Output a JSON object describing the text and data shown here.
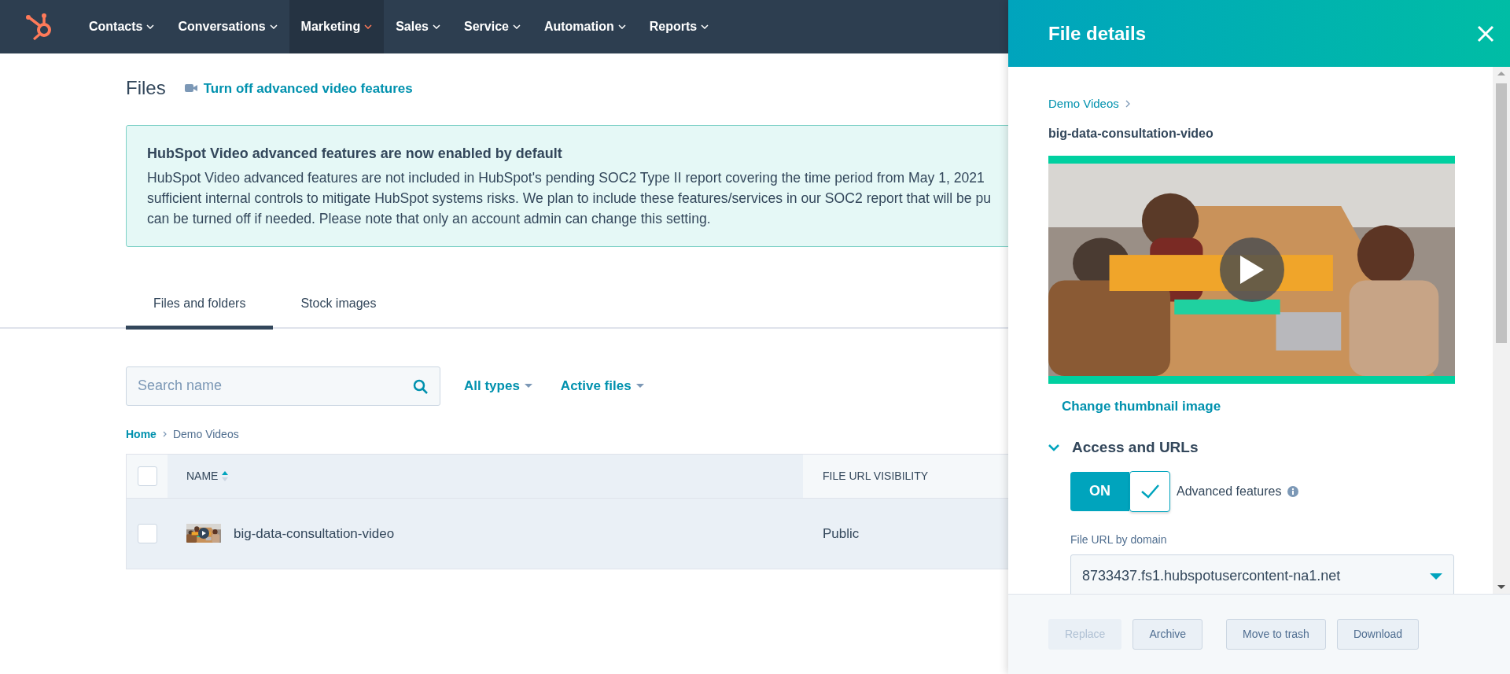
{
  "nav": {
    "items": [
      {
        "label": "Contacts",
        "selected": false
      },
      {
        "label": "Conversations",
        "selected": false
      },
      {
        "label": "Marketing",
        "selected": true
      },
      {
        "label": "Sales",
        "selected": false
      },
      {
        "label": "Service",
        "selected": false
      },
      {
        "label": "Automation",
        "selected": false
      },
      {
        "label": "Reports",
        "selected": false
      }
    ]
  },
  "page": {
    "title": "Files",
    "video_link": "Turn off advanced video features"
  },
  "banner": {
    "title": "HubSpot Video advanced features are now enabled by default",
    "lines": [
      "HubSpot Video advanced features are not included in HubSpot's pending SOC2 Type II report covering the time period from May 1, 2021",
      "sufficient internal controls to mitigate HubSpot systems risks. We plan to include these features/services in our SOC2 report that will be pu",
      "can be turned off if needed. Please note that only an account admin can change this setting."
    ]
  },
  "tabs": [
    {
      "label": "Files and folders",
      "selected": true
    },
    {
      "label": "Stock images",
      "selected": false
    }
  ],
  "search": {
    "placeholder": "Search name"
  },
  "filters": [
    {
      "label": "All types"
    },
    {
      "label": "Active files"
    }
  ],
  "breadcrumb": {
    "home": "Home",
    "current": "Demo Videos"
  },
  "table": {
    "select_all": {
      "checked": false
    },
    "columns": [
      {
        "label": "NAME",
        "sorted": true
      },
      {
        "label": "FILE URL VISIBILITY",
        "sorted": false
      }
    ],
    "rows": [
      {
        "checked": false,
        "name": "big-data-consultation-video",
        "visibility": "Public"
      }
    ]
  },
  "panel": {
    "title": "File details",
    "breadcrumb": "Demo Videos",
    "file_name": "big-data-consultation-video",
    "change_thumbnail": "Change thumbnail image",
    "section": {
      "label": "Access and URLs",
      "expanded": true
    },
    "toggle": {
      "on": true,
      "on_label": "ON",
      "label": "Advanced features"
    },
    "domain": {
      "label": "File URL by domain",
      "value": "8733437.fs1.hubspotusercontent-na1.net"
    },
    "buttons": [
      {
        "label": "Replace",
        "disabled": true
      },
      {
        "label": "Archive",
        "disabled": false
      },
      {
        "label": "Move to trash",
        "disabled": false
      },
      {
        "label": "Download",
        "disabled": false
      }
    ]
  }
}
